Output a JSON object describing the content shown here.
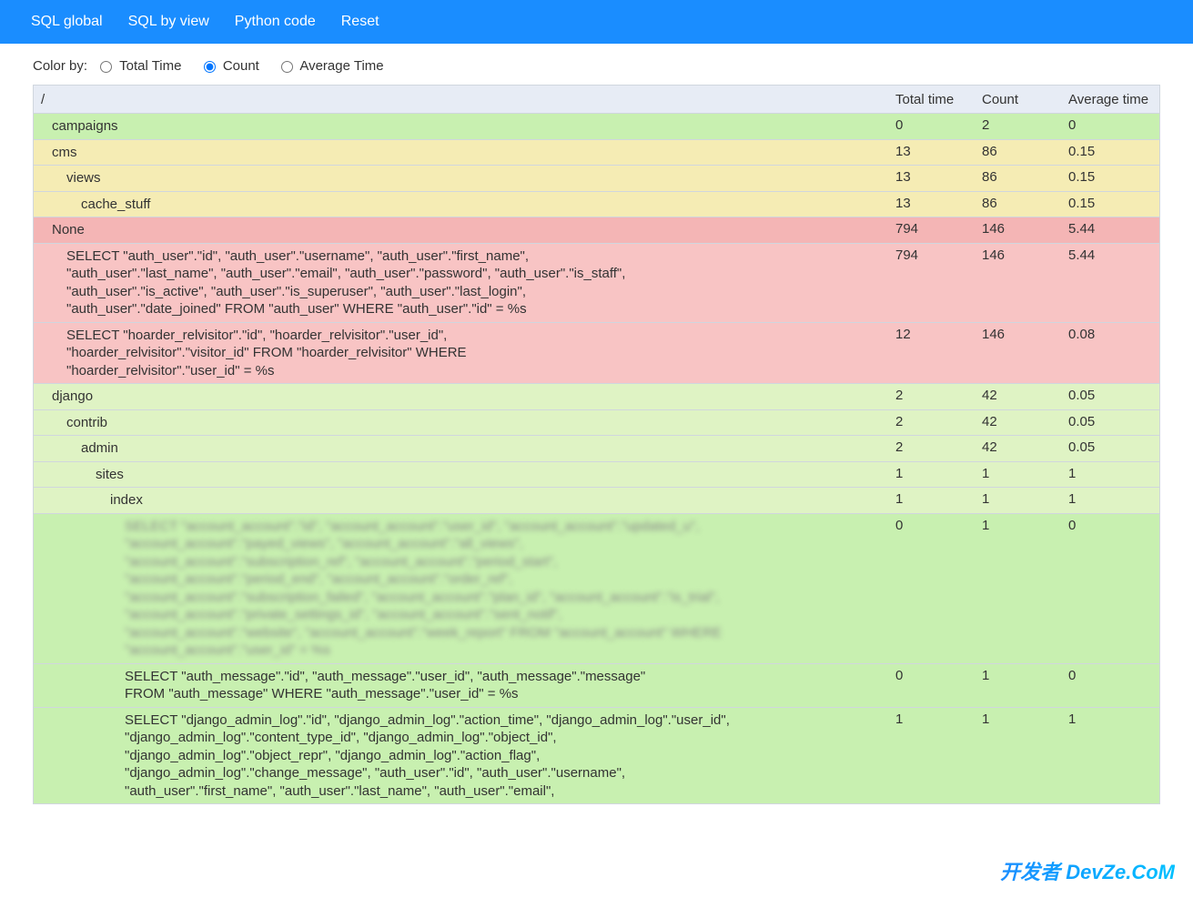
{
  "nav": {
    "items": [
      "SQL global",
      "SQL by view",
      "Python code",
      "Reset"
    ]
  },
  "controls": {
    "label": "Color by:",
    "options": [
      "Total Time",
      "Count",
      "Average Time"
    ],
    "selected": 1
  },
  "columns": {
    "root": "/",
    "total": "Total time",
    "count": "Count",
    "avg": "Average time"
  },
  "rows": [
    {
      "name": "campaigns",
      "total": "0",
      "count": "2",
      "avg": "0",
      "indent": 0,
      "color": "c-green"
    },
    {
      "name": "cms",
      "total": "13",
      "count": "86",
      "avg": "0.15",
      "indent": 0,
      "color": "c-yello"
    },
    {
      "name": "views",
      "total": "13",
      "count": "86",
      "avg": "0.15",
      "indent": 1,
      "color": "c-yello"
    },
    {
      "name": "cache_stuff",
      "total": "13",
      "count": "86",
      "avg": "0.15",
      "indent": 2,
      "color": "c-yello"
    },
    {
      "name": "None",
      "total": "794",
      "count": "146",
      "avg": "5.44",
      "indent": 0,
      "color": "c-red"
    },
    {
      "name": "SELECT \"auth_user\".\"id\", \"auth_user\".\"username\", \"auth_user\".\"first_name\", \"auth_user\".\"last_name\", \"auth_user\".\"email\", \"auth_user\".\"password\", \"auth_user\".\"is_staff\", \"auth_user\".\"is_active\", \"auth_user\".\"is_superuser\", \"auth_user\".\"last_login\", \"auth_user\".\"date_joined\" FROM \"auth_user\" WHERE \"auth_user\".\"id\" = %s",
      "total": "794",
      "count": "146",
      "avg": "5.44",
      "indent": 1,
      "color": "c-redlt",
      "multi": true,
      "maxw": 650
    },
    {
      "name": "SELECT \"hoarder_relvisitor\".\"id\", \"hoarder_relvisitor\".\"user_id\", \"hoarder_relvisitor\".\"visitor_id\" FROM \"hoarder_relvisitor\" WHERE \"hoarder_relvisitor\".\"user_id\" = %s",
      "total": "12",
      "count": "146",
      "avg": "0.08",
      "indent": 1,
      "color": "c-redlt",
      "multi": true,
      "maxw": 600
    },
    {
      "name": "django",
      "total": "2",
      "count": "42",
      "avg": "0.05",
      "indent": 0,
      "color": "c-lgreen"
    },
    {
      "name": "contrib",
      "total": "2",
      "count": "42",
      "avg": "0.05",
      "indent": 1,
      "color": "c-lgreen"
    },
    {
      "name": "admin",
      "total": "2",
      "count": "42",
      "avg": "0.05",
      "indent": 2,
      "color": "c-lgreen"
    },
    {
      "name": "sites",
      "total": "1",
      "count": "1",
      "avg": "1",
      "indent": 3,
      "color": "c-lgreen"
    },
    {
      "name": "index",
      "total": "1",
      "count": "1",
      "avg": "1",
      "indent": 4,
      "color": "c-lgreen"
    },
    {
      "name": "SELECT \"account_account\".\"id\", \"account_account\".\"user_id\", \"account_account\".\"updated_u\", \"account_account\".\"payed_views\", \"account_account\".\"all_views\", \"account_account\".\"subscription_ref\", \"account_account\".\"period_start\", \"account_account\".\"period_end\", \"account_account\".\"order_ref\", \"account_account\".\"subscription_failed\", \"account_account\".\"plan_id\", \"account_account\".\"is_trial\", \"account_account\".\"private_settings_id\", \"account_account\".\"sent_notif\", \"account_account\".\"website\", \"account_account\".\"week_report\" FROM \"account_account\" WHERE \"account_account\".\"user_id\" = %s",
      "total": "0",
      "count": "1",
      "avg": "0",
      "indent": 5,
      "color": "c-green",
      "multi": true,
      "blurred": true,
      "maxw": 670
    },
    {
      "name": "SELECT \"auth_message\".\"id\", \"auth_message\".\"user_id\", \"auth_message\".\"message\" FROM \"auth_message\" WHERE \"auth_message\".\"user_id\" = %s",
      "total": "0",
      "count": "1",
      "avg": "0",
      "indent": 5,
      "color": "c-green",
      "multi": true,
      "maxw": 600
    },
    {
      "name": "SELECT \"django_admin_log\".\"id\", \"django_admin_log\".\"action_time\", \"django_admin_log\".\"user_id\", \"django_admin_log\".\"content_type_id\", \"django_admin_log\".\"object_id\", \"django_admin_log\".\"object_repr\", \"django_admin_log\".\"action_flag\", \"django_admin_log\".\"change_message\", \"auth_user\".\"id\", \"auth_user\".\"username\", \"auth_user\".\"first_name\", \"auth_user\".\"last_name\", \"auth_user\".\"email\",",
      "total": "1",
      "count": "1",
      "avg": "1",
      "indent": 5,
      "color": "c-green",
      "multi": true,
      "maxw": 680
    }
  ],
  "watermark": "开发者 DevZe.CoM"
}
